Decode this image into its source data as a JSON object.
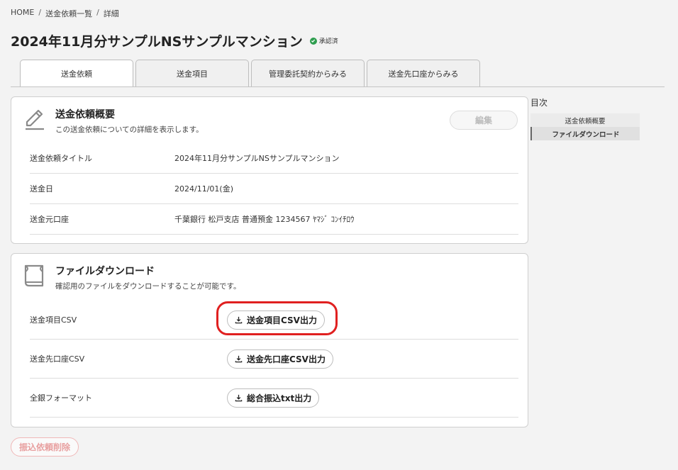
{
  "breadcrumb": [
    "HOME",
    "送金依頼一覧",
    "詳細"
  ],
  "breadcrumb_sep": "/",
  "page_title": "2024年11月分サンプルNSサンプルマンション",
  "status": "承認済",
  "tabs": [
    "送金依頼",
    "送金項目",
    "管理委託契約からみる",
    "送金先口座からみる"
  ],
  "summary": {
    "title": "送金依頼概要",
    "subtitle": "この送金依頼についての詳細を表示します。",
    "edit_label": "編集",
    "rows": [
      {
        "label": "送金依頼タイトル",
        "value": "2024年11月分サンプルNSサンプルマンション"
      },
      {
        "label": "送金日",
        "value": "2024/11/01(金)"
      },
      {
        "label": "送金元口座",
        "value": "千葉銀行 松戸支店 普通預金 1234567 ﾔﾏｼﾞ ｺﾝｲﾁﾛｳ"
      }
    ]
  },
  "download": {
    "title": "ファイルダウンロード",
    "subtitle": "確認用のファイルをダウンロードすることが可能です。",
    "rows": [
      {
        "label": "送金項目CSV",
        "button": "送金項目CSV出力"
      },
      {
        "label": "送金先口座CSV",
        "button": "送金先口座CSV出力"
      },
      {
        "label": "全銀フォーマット",
        "button": "総合振込txt出力"
      }
    ]
  },
  "toc": {
    "title": "目次",
    "items": [
      "送金依頼概要",
      "ファイルダウンロード"
    ]
  },
  "delete_label": "振込依頼削除",
  "colors": {
    "accent_red": "#e02020",
    "status_green": "#2e9e4f"
  }
}
